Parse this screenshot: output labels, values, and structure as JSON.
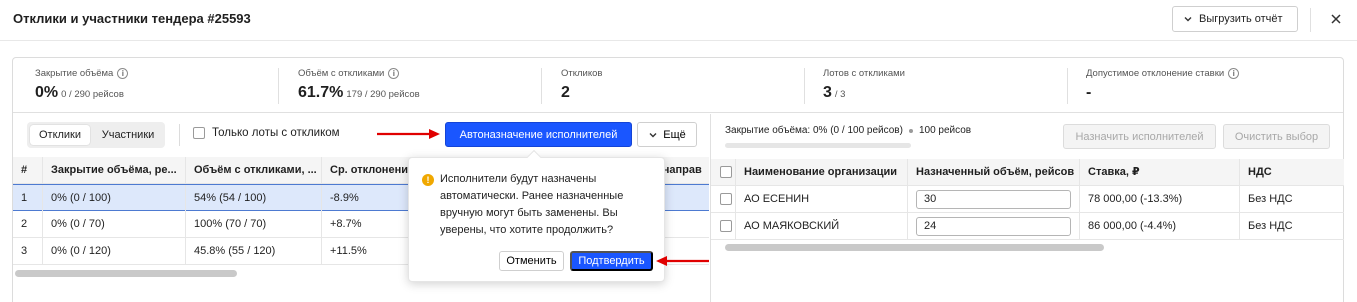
{
  "header": {
    "title": "Отклики и участники тендера #25593",
    "export_label": "Выгрузить отчёт"
  },
  "stats": [
    {
      "label": "Закрытие объёма",
      "value": "0%",
      "sub": "0 / 290 рейсов",
      "info": true
    },
    {
      "label": "Объём с откликами",
      "value": "61.7%",
      "sub": "179 / 290 рейсов",
      "info": true
    },
    {
      "label": "Откликов",
      "value": "2",
      "sub": "",
      "info": false
    },
    {
      "label": "Лотов с откликами",
      "value": "3",
      "sub": "/ 3",
      "info": false
    },
    {
      "label": "Допустимое отклонение ставки",
      "value": "-",
      "sub": "",
      "info": true
    }
  ],
  "toolbar": {
    "tab_responses": "Отклики",
    "tab_participants": "Участники",
    "only_lots_label": "Только лоты с откликом",
    "auto_assign_label": "Автоназначение исполнителей",
    "more_label": "Ещё"
  },
  "left_table": {
    "headers": [
      "#",
      "Закрытие объёма, ре...",
      "Объём с откликами, ...",
      "Ср. отклонение",
      "р направ"
    ],
    "rows": [
      [
        "1",
        "0% (0 / 100)",
        "54% (54 / 100)",
        "-8.9%"
      ],
      [
        "2",
        "0% (0 / 70)",
        "100% (70 / 70)",
        "+8.7%"
      ],
      [
        "3",
        "0% (0 / 120)",
        "45.8% (55 / 120)",
        "+11.5%"
      ]
    ]
  },
  "popup": {
    "message": "Исполнители будут назначены автоматически. Ранее назначенные вручную могут быть заменены. Вы уверены, что хотите продолжить?",
    "cancel_label": "Отменить",
    "confirm_label": "Подтвердить"
  },
  "right_panel": {
    "closing_text": "Закрытие объёма: 0% (0 / 100 рейсов)",
    "trips_text": "100 рейсов",
    "assign_label": "Назначить исполнителей",
    "clear_label": "Очистить выбор",
    "headers": [
      "Наименование организации",
      "Назначенный объём, рейсов",
      "Ставка, ₽",
      "НДС"
    ],
    "rows": [
      [
        "АО ЕСЕНИН",
        "30",
        "78 000,00 (-13.3%)",
        "Без НДС"
      ],
      [
        "АО МАЯКОВСКИЙ",
        "24",
        "86 000,00 (-4.4%)",
        "Без НДС"
      ]
    ]
  },
  "colors": {
    "primary": "#1a56ff",
    "arrow": "#e00000",
    "selected_row": "#dde8fb",
    "warning": "#f0a800"
  },
  "icons": [
    "chevron-down-icon",
    "close-icon",
    "info-icon",
    "warning-icon",
    "arrow-icon"
  ]
}
